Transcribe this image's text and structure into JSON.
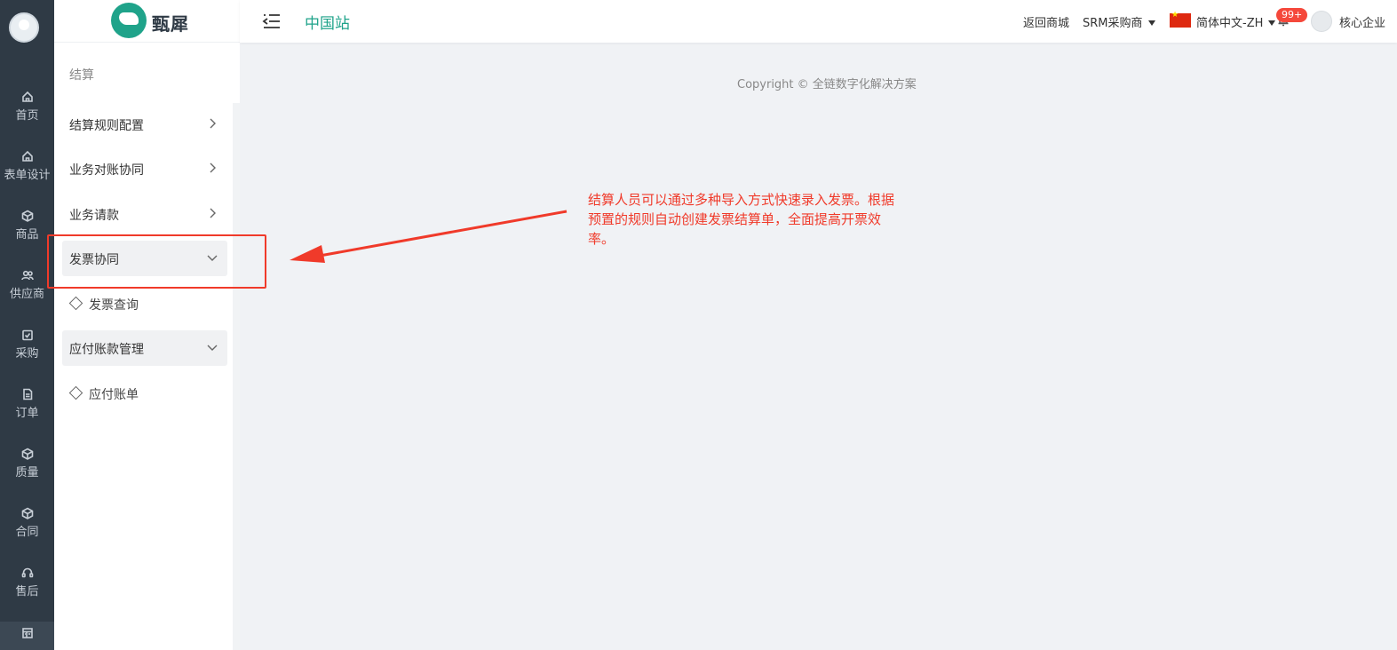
{
  "rail": {
    "items": [
      {
        "label": "首页",
        "icon": "home-icon"
      },
      {
        "label": "表单设计",
        "icon": "home-icon"
      },
      {
        "label": "商品",
        "icon": "cube-icon"
      },
      {
        "label": "供应商",
        "icon": "users-icon"
      },
      {
        "label": "采购",
        "icon": "check-box-icon"
      },
      {
        "label": "订单",
        "icon": "document-icon"
      },
      {
        "label": "质量",
        "icon": "cube-icon"
      },
      {
        "label": "合同",
        "icon": "cube-icon"
      },
      {
        "label": "售后",
        "icon": "headset-icon"
      }
    ],
    "active_icon": "table-icon"
  },
  "sidebar": {
    "logo_text": "甄犀",
    "title": "结算",
    "menu": [
      {
        "label": "结算规则配置",
        "state": "collapsed"
      },
      {
        "label": "业务对账协同",
        "state": "collapsed"
      },
      {
        "label": "业务请款",
        "state": "collapsed"
      },
      {
        "label": "发票协同",
        "state": "expanded",
        "children": [
          "发票查询"
        ]
      },
      {
        "label": "应付账款管理",
        "state": "expanded",
        "children": [
          "应付账单"
        ]
      }
    ]
  },
  "header": {
    "site_name": "中国站",
    "back_to_mall": "返回商城",
    "role": "SRM采购商",
    "language": "简体中文-ZH",
    "notifications_badge": "99+",
    "company": "核心企业"
  },
  "main": {
    "copyright": "Copyright © 全链数字化解决方案"
  },
  "annotation": {
    "text": "结算人员可以通过多种导入方式快速录入发票。根据预置的规则自动创建发票结算单，全面提高开票效率。",
    "color": "#f03a2a"
  },
  "colors": {
    "brand": "#1fa38a",
    "rail_bg": "#2f3a45",
    "badge": "#f5483b"
  }
}
